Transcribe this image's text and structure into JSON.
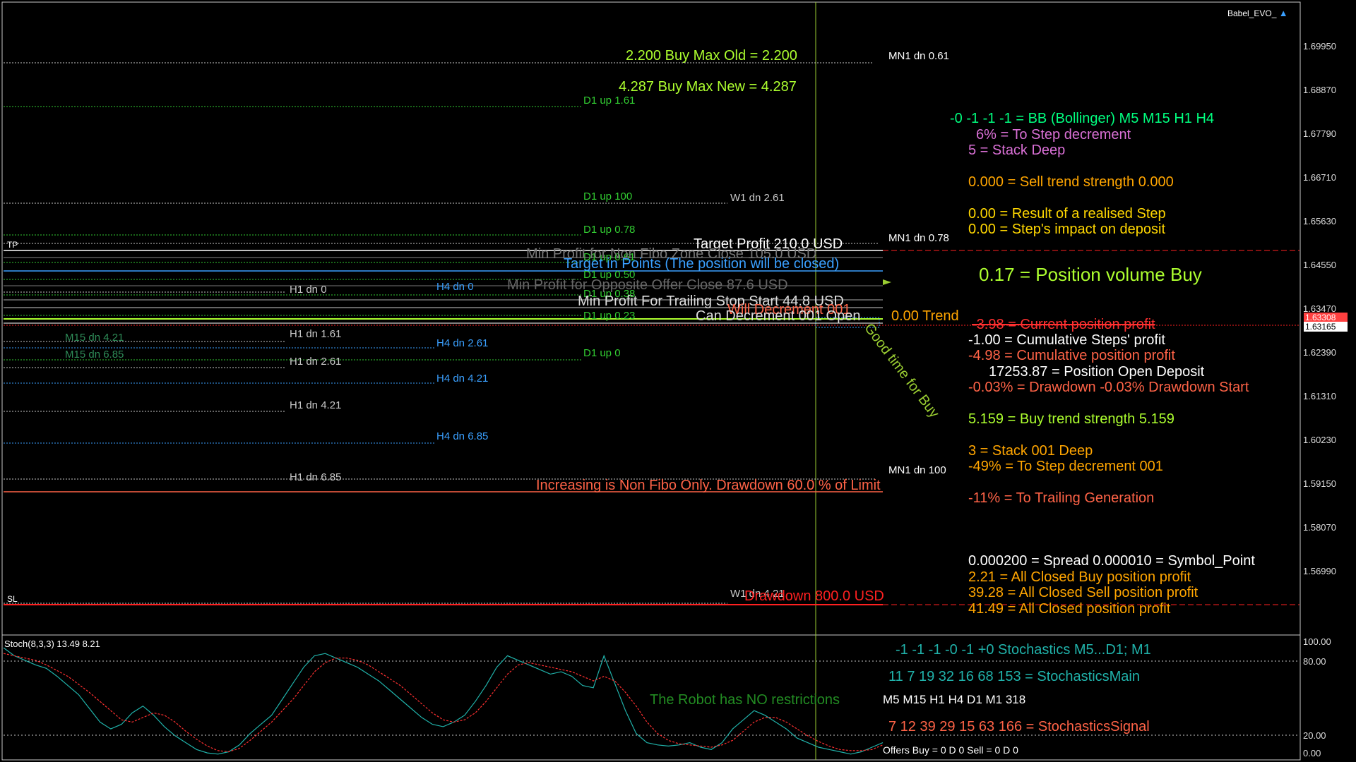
{
  "window": {
    "title": "Babel_EVO_"
  },
  "colors": {
    "background": "#000000",
    "axis": "#c8c8c8",
    "green": "#7fff00",
    "yellow_green": "#adff2f",
    "orange": "#ffa500",
    "salmon": "#ff6347",
    "white": "#ffffff",
    "red": "#ff2020",
    "steel_blue": "#3aa0ff",
    "teal": "#20b2aa",
    "plum": "#da70d6"
  },
  "price_axis": [
    "1.69950",
    "1.68870",
    "1.67790",
    "1.66710",
    "1.65630",
    "1.64550",
    "1.63470",
    "1.62390",
    "1.61310",
    "1.60230",
    "1.59150",
    "1.58070",
    "1.56990"
  ],
  "price_tags": {
    "ask": "1.63308",
    "bid": "1.63165"
  },
  "stoch_axis": [
    "100.00",
    "80.00",
    "20.00",
    "0.00"
  ],
  "stoch_header": "Stoch(8,3,3) 13.49 8.21",
  "levels": {
    "mn1_dn_061": "MN1 dn 0.61",
    "d1_up_161": "D1 up 1.61",
    "d1_up_100": "D1 up 100",
    "w1_dn_261": "W1 dn 2.61",
    "d1_up_078": "D1 up 0.78",
    "mn1_dn_078": "MN1 dn 0.78",
    "tp": "TP",
    "d1_up_061": "D1 up 0.61",
    "d1_up_050": "D1 up 0.50",
    "h1_dn_0": "H1 dn 0",
    "h4_dn_0": "H4 dn 0",
    "d1_up_038": "D1 up 0.38",
    "d1_up_023": "D1 up 0.23",
    "h1_dn_161": "H1 dn 1.61",
    "m15_dn_421": "M15 dn 4.21",
    "h4_dn_261": "H4 dn 2.61",
    "m15_dn_685": "M15 dn 6.85",
    "d1_up_0": "D1 up 0",
    "h1_dn_261": "H1 dn 2.61",
    "h4_dn_421": "H4 dn 4.21",
    "h1_dn_421": "H1 dn 4.21",
    "h4_dn_685": "H4 dn 6.85",
    "h1_dn_685": "H1 dn 6.85",
    "mn1_dn_100": "MN1 dn 100",
    "sl": "SL",
    "w1_dn_421": "W1 dn 4.21"
  },
  "chart_text": {
    "buy_max_old": "2.200 Buy Max Old = 2.200",
    "buy_max_new": "4.287 Buy Max New = 4.287",
    "target_profit": "Target Profit 210.0 USD",
    "min_profit_fibo": "Min Profit for Non Fibo Zone Close  105.0 USD",
    "target_in_points": "Target in   Points (The position will be closed)",
    "min_profit_opposite": "Min Profit for Opposite Offer Close  87.6 USD",
    "min_profit_trailing": "Min Profit For Trailing Stop Start 44.8 USD",
    "will_decrement": "Will Decrement 001",
    "can_decrement": "Can Decrement 001   Open",
    "zero_trend": "0.00 Trend",
    "good_time": "Good time for Buy",
    "increasing_non_fibo": "Increasing is Non Fibo Only. Drawdown 60.0  % of Limit",
    "drawdown_usd": "Drawdown 800.0 USD"
  },
  "panel": {
    "bb_line": "-0 -1 -1 -1 = BB (Bollinger) M5 M15 H1 H4",
    "step_decrement": "6% =  To Step decrement",
    "stack_deep": "5 =  Stack Deep",
    "sell_trend": "0.000 = Sell trend strength 0.000",
    "result_step": "0.00 = Result of a realised Step",
    "step_impact": "0.00 = Step's impact on deposit",
    "position_volume": "0.17 = Position volume Buy",
    "current_profit": "-3.98 = Current position profit",
    "cumulative_steps": "-1.00 = Cumulative Steps' profit",
    "cumulative_position": "-4.98 = Cumulative position profit",
    "open_deposit": "17253.87 = Position Open Deposit",
    "drawdown": "-0.03% = Drawdown   -0.03%  Drawdown Start",
    "buy_trend": "5.159 = Buy trend strength 5.159",
    "stack_001": "3 =  Stack 001 Deep",
    "step_decrement_001": "-49% =  To Step decrement 001",
    "trailing_generation": "-11% =  To Trailing Generation",
    "spread": "0.000200 = Spread   0.000010 = Symbol_Point",
    "closed_buy": "2.21 =  All Closed Buy position profit",
    "closed_sell": "39.28 =  All Closed Sell position profit",
    "closed_all": "41.49 =  All Closed position profit"
  },
  "stoch_panel": {
    "stochastics_line": "-1   -1   -1   -0   -1   +0   Stochastics M5...D1; M1",
    "main_line": "11   7   19   32   16   68   153 = StochasticsMain",
    "no_restrictions": "The Robot has NO restrictions",
    "timeframes": "M5  M15  H1  H4  D1  M1  318",
    "signal_line": "7   12   39   29   15   63   166 = StochasticsSignal",
    "offers": "Offers Buy = 0 D 0  Sell = 0 D 0"
  },
  "stoch_main": [
    95,
    88,
    84,
    80,
    77,
    70,
    62,
    54,
    42,
    30,
    24,
    28,
    38,
    44,
    36,
    26,
    18,
    12,
    6,
    3,
    2,
    4,
    10,
    20,
    28,
    36,
    50,
    64,
    78,
    88,
    90,
    86,
    82,
    78,
    72,
    66,
    58,
    50,
    42,
    34,
    28,
    26,
    30,
    36,
    48,
    62,
    78,
    88,
    84,
    80,
    76,
    72,
    74,
    70,
    62,
    60,
    88,
    64,
    40,
    20,
    12,
    10,
    9,
    10,
    12,
    8,
    6,
    12,
    24,
    32,
    40,
    36,
    30,
    24,
    16,
    12,
    8,
    6,
    4,
    2,
    4,
    8,
    12
  ],
  "stoch_signal": [
    90,
    88,
    86,
    84,
    80,
    75,
    70,
    63,
    56,
    48,
    40,
    32,
    30,
    34,
    38,
    36,
    30,
    22,
    15,
    9,
    5,
    4,
    7,
    14,
    22,
    30,
    40,
    50,
    62,
    74,
    82,
    86,
    86,
    84,
    80,
    74,
    68,
    62,
    54,
    46,
    38,
    32,
    30,
    32,
    38,
    48,
    60,
    72,
    80,
    82,
    80,
    78,
    76,
    74,
    70,
    66,
    70,
    66,
    56,
    44,
    30,
    20,
    14,
    11,
    10,
    9,
    8,
    10,
    14,
    22,
    30,
    34,
    34,
    30,
    24,
    18,
    13,
    9,
    6,
    5,
    5,
    6,
    10
  ]
}
